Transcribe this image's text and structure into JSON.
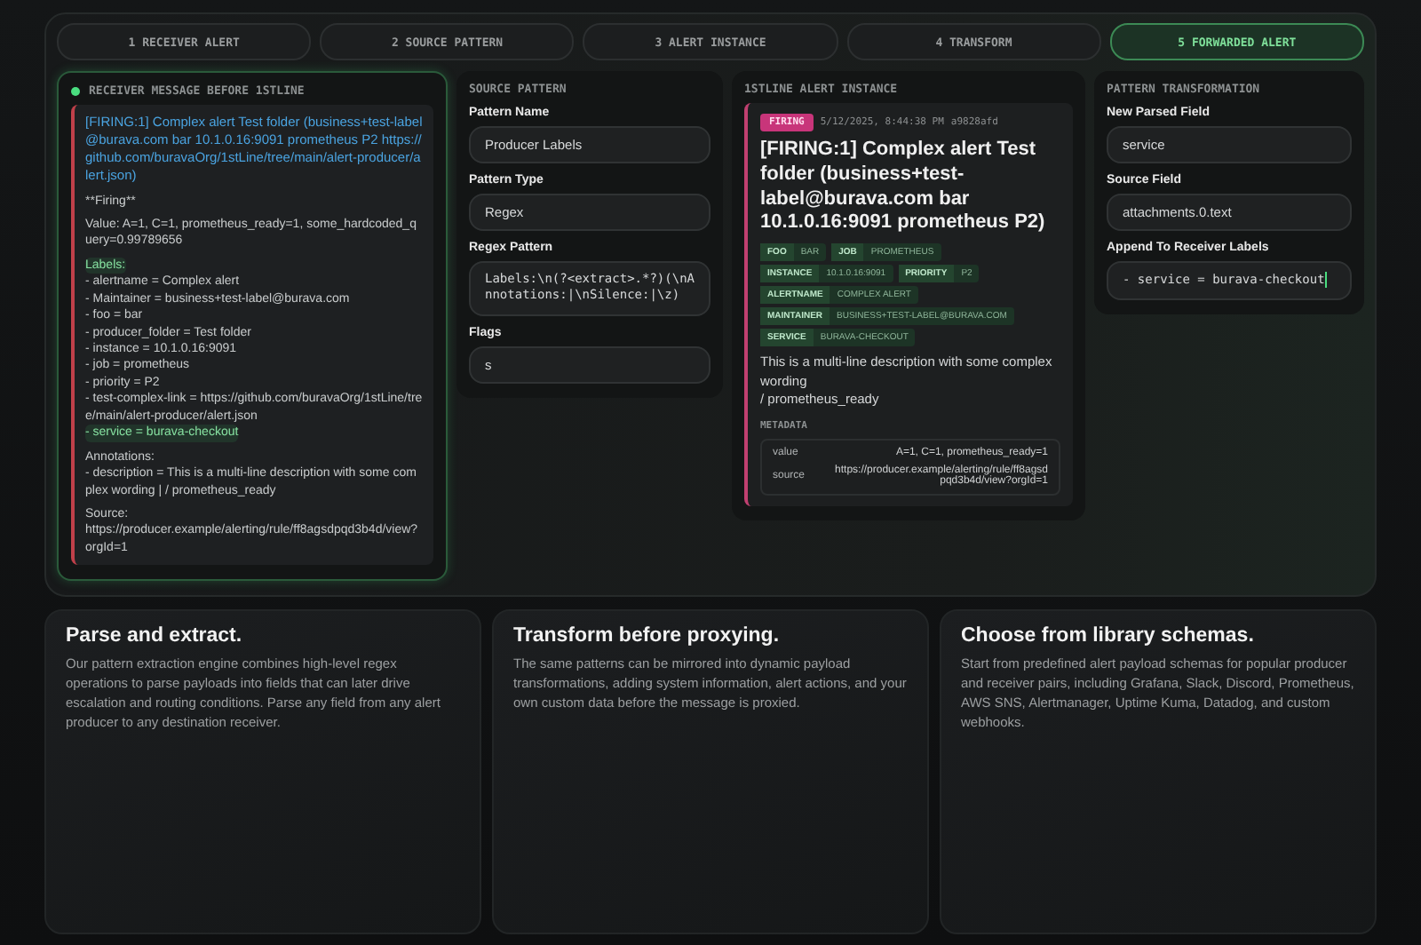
{
  "steps": [
    {
      "label": "1 RECEIVER ALERT",
      "selected": false
    },
    {
      "label": "2 SOURCE PATTERN",
      "selected": false
    },
    {
      "label": "3 ALERT INSTANCE",
      "selected": false
    },
    {
      "label": "4 TRANSFORM",
      "selected": false
    },
    {
      "label": "5 FORWARDED ALERT",
      "selected": true
    }
  ],
  "receiver": {
    "heading": "RECEIVER MESSAGE BEFORE 1STLINE",
    "title": "[FIRING:1] Complex alert Test folder (business+test-label@burava.com bar 10.1.0.16:9091 prometheus P2 https://github.com/buravaOrg/1stLine/tree/main/alert-producer/alert.json)",
    "paragraphs": [
      [
        {
          "text": "**Firing**",
          "highlighted": false
        }
      ],
      [
        {
          "text": "Value: A=1, C=1, prometheus_ready=1, some_hardcoded_query=0.99789656",
          "highlighted": false
        }
      ],
      [
        {
          "text": "Labels:",
          "highlighted": true
        },
        {
          "text": "- alertname = Complex alert",
          "highlighted": false
        },
        {
          "text": "- Maintainer = business+test-label@burava.com",
          "highlighted": false
        },
        {
          "text": "- foo = bar",
          "highlighted": false
        },
        {
          "text": "- producer_folder = Test folder",
          "highlighted": false
        },
        {
          "text": "- instance = 10.1.0.16:9091",
          "highlighted": false
        },
        {
          "text": "- job = prometheus",
          "highlighted": false
        },
        {
          "text": "- priority = P2",
          "highlighted": false
        },
        {
          "text": "- test-complex-link = https://github.com/buravaOrg/1stLine/tree/main/alert-producer/alert.json",
          "highlighted": false
        },
        {
          "text": "- service = burava-checkout",
          "highlighted": true
        }
      ],
      [
        {
          "text": "Annotations:",
          "highlighted": false
        },
        {
          "text": "- description = This is a multi-line description with some complex wording | / prometheus_ready",
          "highlighted": false
        }
      ],
      [
        {
          "text": "Source:",
          "highlighted": false
        },
        {
          "text": "https://producer.example/alerting/rule/ff8agsdpqd3b4d/view?orgId=1",
          "highlighted": false
        }
      ]
    ]
  },
  "source_pattern": {
    "heading": "SOURCE PATTERN",
    "fields": [
      {
        "label": "Pattern Name",
        "value": "Producer Labels",
        "kind": "text"
      },
      {
        "label": "Pattern Type",
        "value": "Regex",
        "kind": "text"
      },
      {
        "label": "Regex Pattern",
        "value": "Labels:\\n(?<extract>.*?)(\\nAnnotations:|\\nSilence:|\\z)",
        "kind": "code"
      },
      {
        "label": "Flags",
        "value": "s",
        "kind": "text"
      }
    ]
  },
  "instance": {
    "heading": "1STLINE ALERT INSTANCE",
    "badge": "FIRING",
    "timestamp": "5/12/2025, 8:44:38 PM",
    "id": "a9828afd",
    "title": "[FIRING:1] Complex alert Test folder (business+test-label@burava.com bar 10.1.0.16:9091 prometheus P2)",
    "tag_rows": [
      [
        {
          "key": "FOO",
          "value": "BAR"
        },
        {
          "key": "JOB",
          "value": "PROMETHEUS"
        }
      ],
      [
        {
          "key": "INSTANCE",
          "value": "10.1.0.16:9091"
        },
        {
          "key": "PRIORITY",
          "value": "P2"
        }
      ],
      [
        {
          "key": "ALERTNAME",
          "value": "COMPLEX ALERT"
        }
      ],
      [
        {
          "key": "MAINTAINER",
          "value": "BUSINESS+TEST-LABEL@BURAVA.COM"
        }
      ],
      [
        {
          "key": "SERVICE",
          "value": "BURAVA-CHECKOUT"
        }
      ]
    ],
    "description": [
      "This is a multi-line description with some complex wording",
      "/ prometheus_ready"
    ],
    "metadata_heading": "METADATA",
    "metadata": [
      {
        "key": "value",
        "value": "A=1, C=1, prometheus_ready=1"
      },
      {
        "key": "source",
        "value": "https://producer.example/alerting/rule/ff8agsdpqd3b4d/view?orgId=1"
      }
    ]
  },
  "transformation": {
    "heading": "PATTERN TRANSFORMATION",
    "fields": [
      {
        "label": "New Parsed Field",
        "value": "service",
        "kind": "text"
      },
      {
        "label": "Source Field",
        "value": "attachments.0.text",
        "kind": "text"
      },
      {
        "label": "Append To Receiver Labels",
        "value": "- service = burava-checkout",
        "kind": "code"
      }
    ]
  },
  "features": [
    {
      "title": "Parse and extract.",
      "body": "Our pattern extraction engine combines high-level regex operations to parse payloads into fields that can later drive escalation and routing conditions. Parse any field from any alert producer to any destination receiver."
    },
    {
      "title": "Transform before proxying.",
      "body": "The same patterns can be mirrored into dynamic payload transformations, adding system information, alert actions, and your own custom data before the message is proxied."
    },
    {
      "title": "Choose from library schemas.",
      "body": "Start from predefined alert payload schemas for popular producer and receiver pairs, including Grafana, Slack, Discord, Prometheus, AWS SNS, Alertmanager, Uptime Kuma, Datadog, and custom webhooks."
    }
  ]
}
